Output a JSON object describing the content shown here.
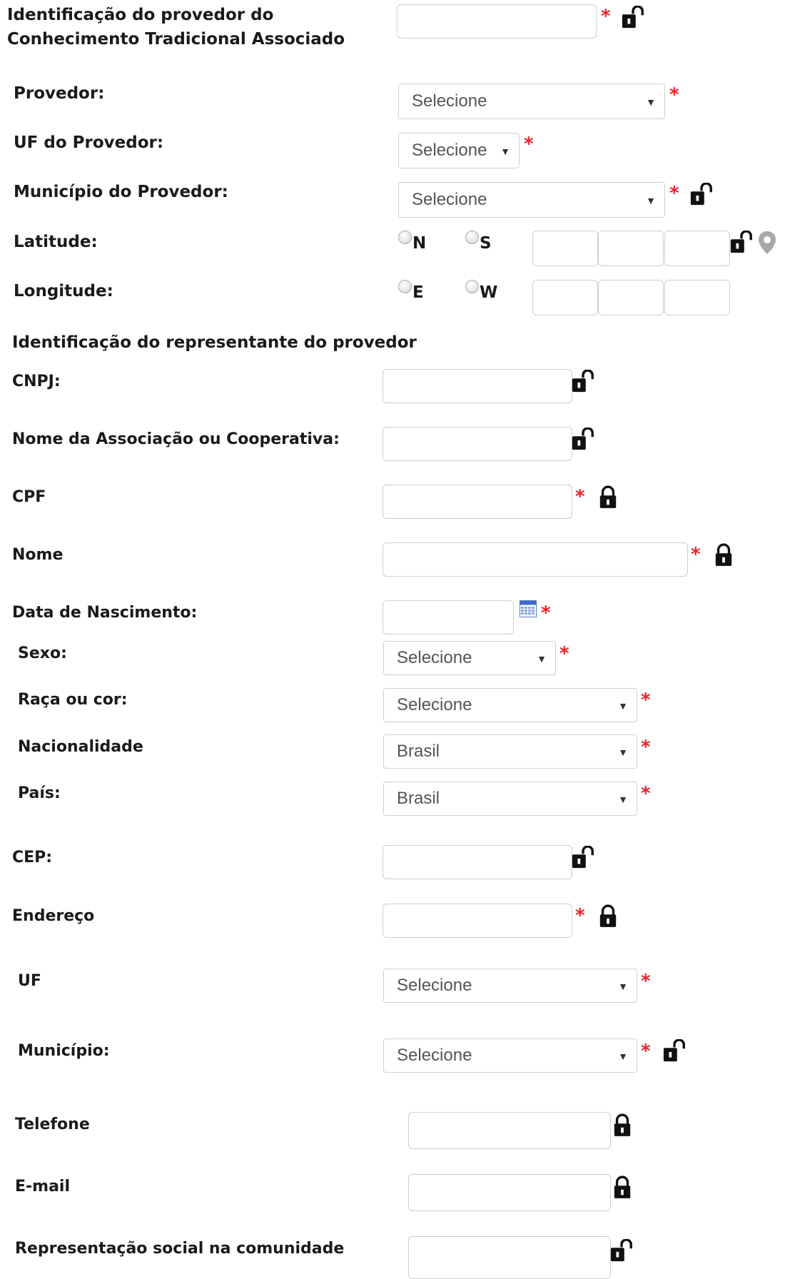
{
  "colors": {
    "required": "#e8232a",
    "input_border": "#cfcfcf",
    "label": "#1a1a1a"
  },
  "provider_section": {
    "id_label": "Identificação do provedor do Conhecimento Tradicional Associado",
    "provedor_label": "Provedor:",
    "provedor_value": "Selecione",
    "uf_label": "UF do Provedor:",
    "uf_value": "Selecione",
    "municipio_label": "Município do Provedor:",
    "municipio_value": "Selecione",
    "latitude_label": "Latitude:",
    "lat_n": "N",
    "lat_s": "S",
    "longitude_label": "Longitude:",
    "lon_e": "E",
    "lon_w": "W"
  },
  "representative_section": {
    "title": "Identificação do representante do provedor",
    "cnpj_label": "CNPJ:",
    "associacao_label": "Nome da Associação ou Cooperativa:",
    "cpf_label": "CPF",
    "nome_label": "Nome",
    "nascimento_label": "Data de Nascimento:",
    "sexo_label": "Sexo:",
    "sexo_value": "Selecione",
    "raca_label": "Raça ou cor:",
    "raca_value": "Selecione",
    "nacionalidade_label": "Nacionalidade",
    "nacionalidade_value": "Brasil",
    "pais_label": "País:",
    "pais_value": "Brasil",
    "cep_label": "CEP:",
    "endereco_label": "Endereço",
    "uf_label": "UF",
    "uf_value": "Selecione",
    "municipio_label": "Município:",
    "municipio_value": "Selecione",
    "telefone_label": "Telefone",
    "email_label": "E-mail",
    "representacao_label": "Representação social na comunidade"
  },
  "required_mark": "*",
  "caret": "▼",
  "icons": [
    "unlock-icon",
    "lock-icon",
    "calendar-icon",
    "map-pin-icon"
  ]
}
